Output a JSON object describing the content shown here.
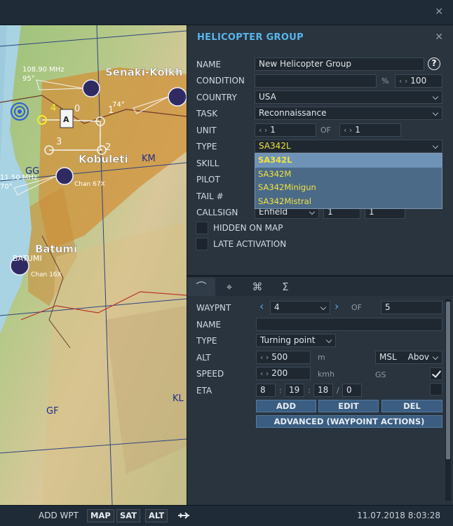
{
  "window": {
    "close_glyph": "✕"
  },
  "map": {
    "cities": [
      "Senaki-Kolkh",
      "Kobuleti",
      "Batumi"
    ],
    "freq_labels": [
      "108.90 MHz",
      "95°",
      "74°",
      "Chan 67X",
      "11.50 MHz",
      "70°",
      "Chan 16X"
    ],
    "grid_labels": [
      "GG",
      "KM",
      "GF",
      "KL"
    ],
    "waypoint_numbers": [
      "0",
      "1",
      "2",
      "3",
      "4"
    ],
    "airport_code": "BATUMI"
  },
  "panel": {
    "title": "HELICOPTER GROUP",
    "close_glyph": "✕",
    "help_glyph": "?",
    "labels": {
      "name": "NAME",
      "condition": "CONDITION",
      "country": "COUNTRY",
      "task": "TASK",
      "unit": "UNIT",
      "type": "TYPE",
      "skill": "SKILL",
      "pilot": "PILOT",
      "tail": "TAIL #",
      "callsign": "CALLSIGN",
      "hidden": "HIDDEN ON MAP",
      "late": "LATE ACTIVATION"
    },
    "name_value": "New Helicopter Group",
    "condition_value": "",
    "condition_unit": "%",
    "condition_percent": "100",
    "country_value": "USA",
    "task_value": "Reconnaissance",
    "unit_value": "1",
    "of_label": "OF",
    "unit_of_value": "1",
    "type_value": "SA342L",
    "type_options": [
      "SA342L",
      "SA342M",
      "SA342Minigun",
      "SA342Mistral"
    ],
    "callsign_value": "Enfield",
    "callsign_num1": "1",
    "callsign_num2": "1",
    "hidden_on_map": false,
    "late_activation": false
  },
  "waypoint": {
    "tabs": [
      "route-icon",
      "target-icon",
      "triggers-icon",
      "summary-icon"
    ],
    "labels": {
      "waypnt": "WAYPNT",
      "of": "OF",
      "name": "NAME",
      "type": "TYPE",
      "alt": "ALT",
      "speed": "SPEED",
      "eta": "ETA",
      "gs": "GS"
    },
    "current": "4",
    "total": "5",
    "name_value": "",
    "type_value": "Turning point",
    "alt_value": "500",
    "alt_unit": "m",
    "alt_ref": "MSL",
    "alt_ref2": "Abov",
    "speed_value": "200",
    "speed_unit": "kmh",
    "gs_checked": true,
    "eta_checked": false,
    "eta_h": "8",
    "eta_m": "19",
    "eta_s": "18",
    "eta_d": "0",
    "sep_colon": ":",
    "sep_slash": "/",
    "buttons": {
      "add": "ADD",
      "edit": "EDIT",
      "del": "DEL",
      "advanced": "ADVANCED (WAYPOINT ACTIONS)"
    }
  },
  "statusbar": {
    "add_wpt": "ADD WPT",
    "map": "MAP",
    "sat": "SAT",
    "alt": "ALT",
    "datetime": "11.07.2018 8:03:28"
  },
  "stepper_glyph": "‹ ›",
  "colors": {
    "accent": "#58b6ea",
    "panel": "#29343f",
    "dropdown": "#4b6a88",
    "option_text": "#f1e23e",
    "button": "#3a5d81"
  }
}
